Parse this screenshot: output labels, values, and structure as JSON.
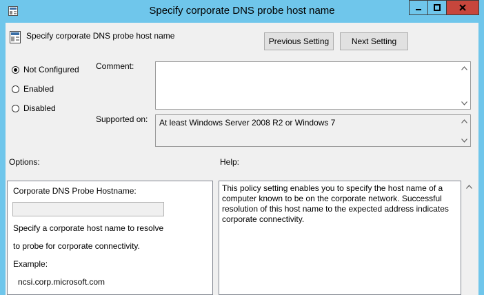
{
  "window": {
    "title": "Specify corporate DNS probe host name",
    "controls": {
      "minimize": "—",
      "maximize": "☐",
      "close": "✕"
    }
  },
  "header": {
    "title": "Specify corporate DNS probe host name",
    "prev_label": "Previous Setting",
    "next_label": "Next Setting"
  },
  "state": {
    "options": [
      {
        "label": "Not Configured",
        "selected": true
      },
      {
        "label": "Enabled",
        "selected": false
      },
      {
        "label": "Disabled",
        "selected": false
      }
    ]
  },
  "comment": {
    "label": "Comment:",
    "value": ""
  },
  "supported": {
    "label": "Supported on:",
    "value": "At least Windows Server 2008 R2 or Windows 7"
  },
  "options_panel": {
    "label": "Options:",
    "field_label": "Corporate DNS Probe Hostname:",
    "field_value": "",
    "desc_line1": "Specify a corporate host name to resolve",
    "desc_line2": "to probe for corporate connectivity.",
    "example_label": "Example:",
    "example_value": "ncsi.corp.microsoft.com"
  },
  "help_panel": {
    "label": "Help:",
    "text": "This policy setting enables you to specify the host name of a computer known to be on the corporate network. Successful resolution of this host name to the expected address indicates corporate connectivity."
  },
  "colors": {
    "titlebar": "#6fc6eb",
    "close_button": "#c7463c",
    "client_bg": "#f0f0f0"
  }
}
